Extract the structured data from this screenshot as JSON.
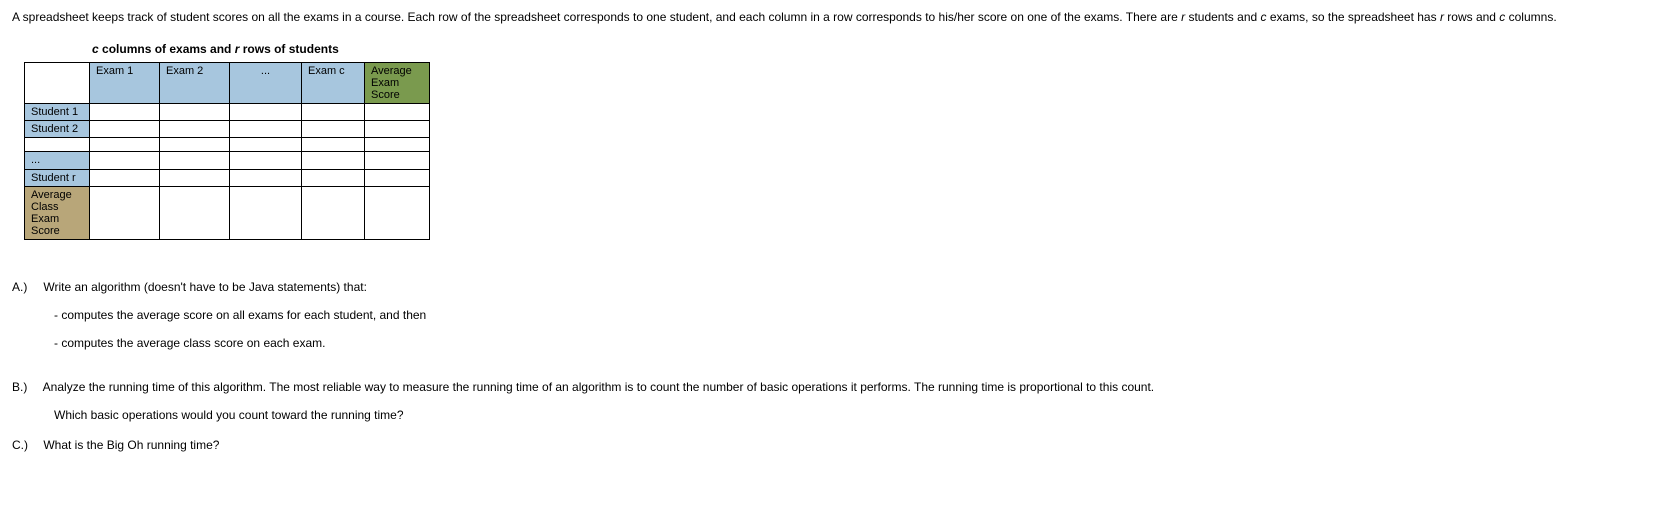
{
  "intro": {
    "p1a": "A spreadsheet keeps track of student scores on all the exams in a course.  Each row of the spreadsheet corresponds to one student, and each column in a row corresponds to his/her score on one of the exams.  There are ",
    "v1": "r",
    "p1b": " students and ",
    "v2": "c",
    "p1c": " exams, so the spreadsheet has ",
    "v3": "r",
    "p1d": " rows and ",
    "v4": "c",
    "p1e": " columns."
  },
  "caption": {
    "a": "c",
    "b": " columns of exams and ",
    "c": "r",
    "d": " rows of students"
  },
  "table": {
    "headers": {
      "exam1": "Exam 1",
      "exam2": "Exam 2",
      "dots": "...",
      "examc": "Exam c",
      "avg1": "Average",
      "avg2": "Exam Score"
    },
    "rows": {
      "s1": "Student 1",
      "s2": "Student 2",
      "sdots": "...",
      "sr": "Student r",
      "avg_a": "Average",
      "avg_b": "Class Exam",
      "avg_c": "Score"
    }
  },
  "qA": {
    "label": "A.)",
    "text": "Write an algorithm (doesn't have to be Java statements) that:",
    "sub1": "- computes the average score on all exams for each student, and then",
    "sub2": "- computes the average class score on each exam."
  },
  "qB": {
    "label": "B.)",
    "text": "Analyze the running time of this algorithm.  The most reliable way to measure the running time of an algorithm is to count the number of basic operations it performs.  The running time is proportional to this count.",
    "sub1": "Which basic operations would you count toward the running time?"
  },
  "qC": {
    "label": "C.)",
    "text": "What is the Big Oh running time?"
  }
}
